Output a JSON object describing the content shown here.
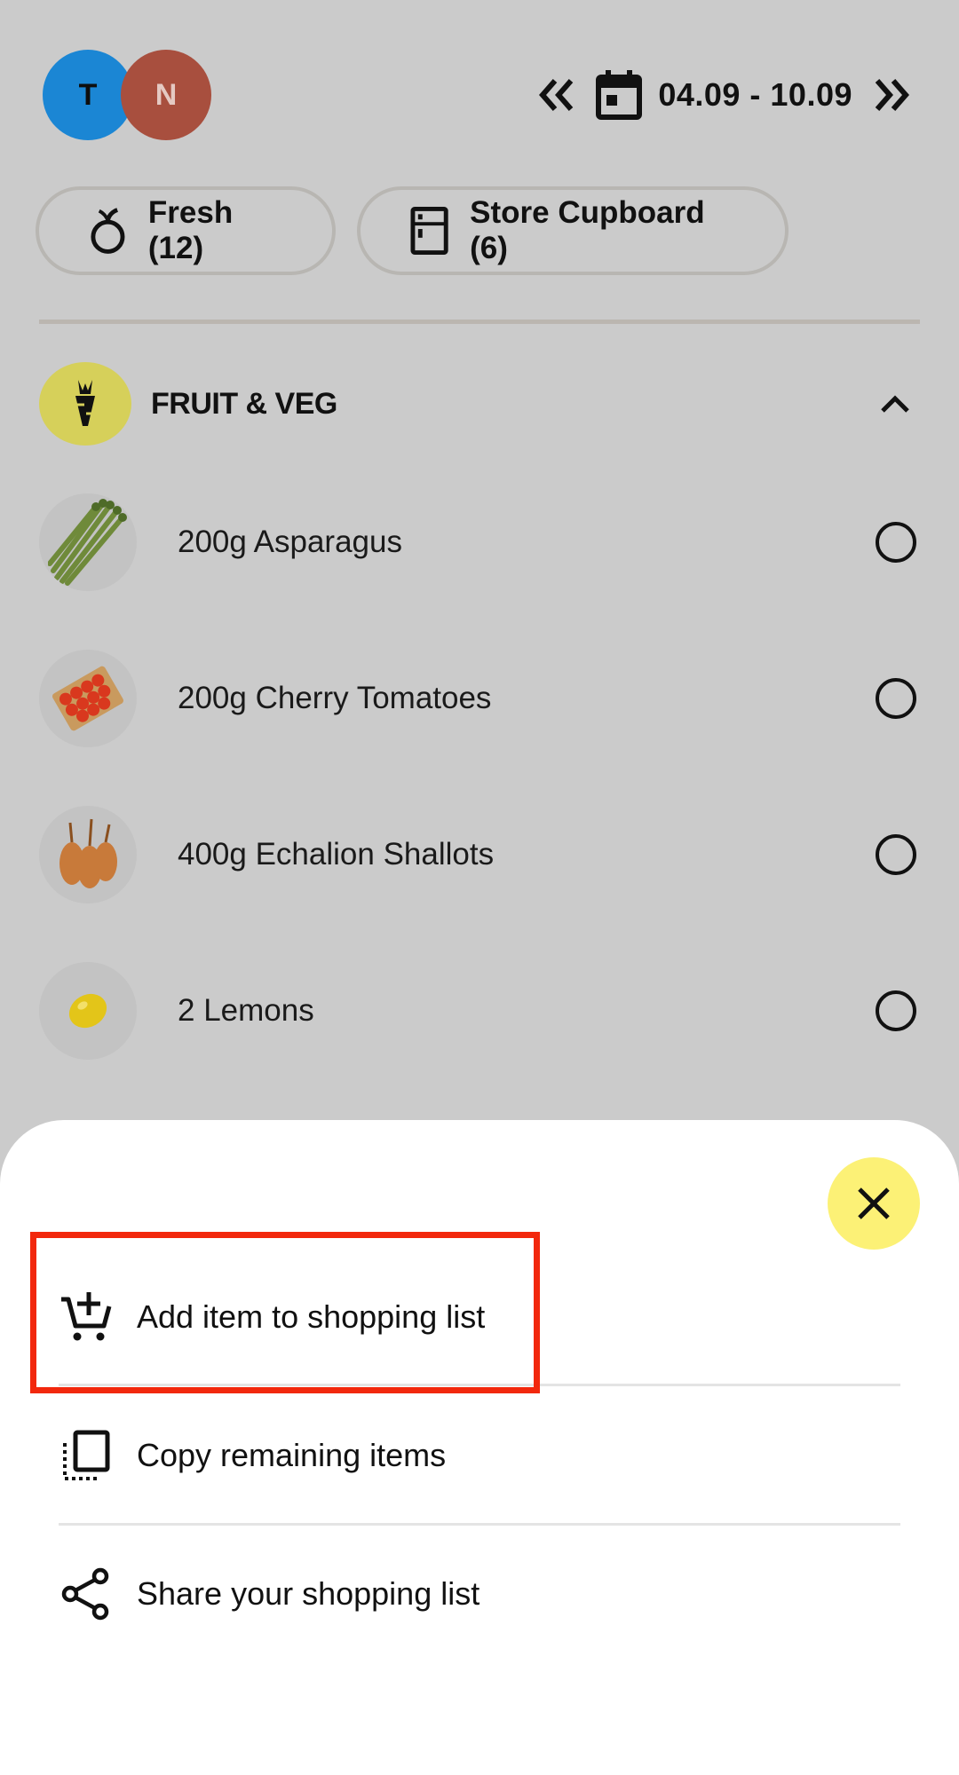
{
  "header": {
    "avatars": [
      {
        "initial": "T",
        "color": "#1b86d4"
      },
      {
        "initial": "N",
        "color": "#a84f3e"
      }
    ],
    "week_range": "04.09 - 10.09",
    "icons": {
      "prev": "chevrons-left-icon",
      "calendar": "calendar-icon",
      "next": "chevrons-right-icon"
    }
  },
  "filters": {
    "fresh": {
      "label": "Fresh (12)",
      "icon": "apple-icon"
    },
    "cupboard": {
      "label": "Store Cupboard (6)",
      "icon": "cupboard-icon"
    }
  },
  "category": {
    "label": "FRUIT & VEG",
    "icon": "carrot-icon",
    "accent": "#d6d05a"
  },
  "items": [
    {
      "name": "200g Asparagus"
    },
    {
      "name": "200g Cherry Tomatoes"
    },
    {
      "name": "400g Echalion Shallots"
    },
    {
      "name": "2 Lemons"
    }
  ],
  "sheet": {
    "close_color": "#fcf176",
    "actions": [
      {
        "label": "Add item to shopping list",
        "icon": "add-to-cart-icon"
      },
      {
        "label": "Copy remaining items",
        "icon": "copy-icon"
      },
      {
        "label": "Share your shopping list",
        "icon": "share-icon"
      }
    ]
  },
  "highlight_color": "#f2280d"
}
